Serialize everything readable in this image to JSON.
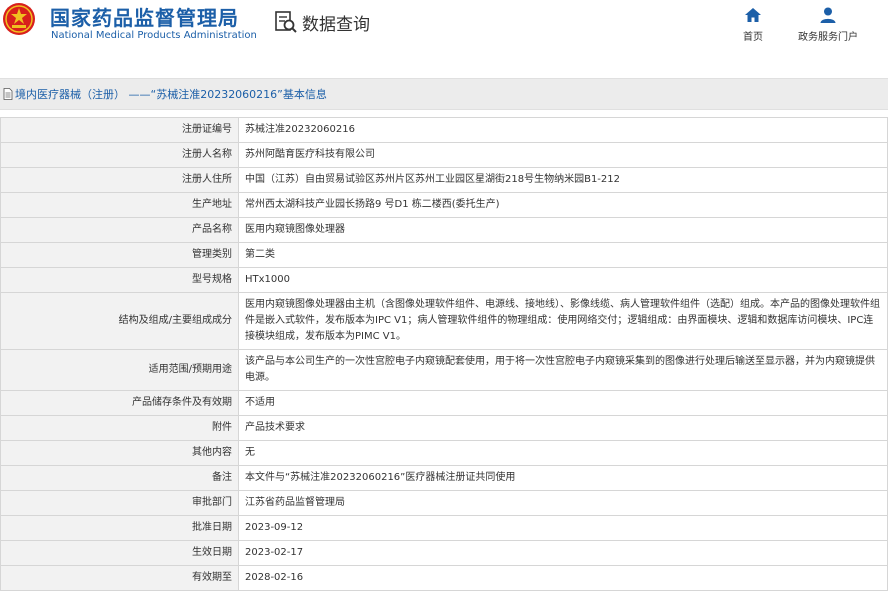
{
  "header": {
    "brand_cn": "国家药品监督管理局",
    "brand_en": "National Medical Products Administration",
    "query_title": "数据查询",
    "nav": [
      {
        "label": "首页",
        "icon": "home-icon"
      },
      {
        "label": "政务服务门户",
        "icon": "user-icon"
      }
    ]
  },
  "breadcrumb": {
    "text": "境内医疗器械（注册） ——“苏械注准20232060216”基本信息"
  },
  "fields": [
    {
      "label": "注册证编号",
      "value": "苏械注准20232060216"
    },
    {
      "label": "注册人名称",
      "value": "苏州阿酷育医疗科技有限公司"
    },
    {
      "label": "注册人住所",
      "value": "中国（江苏）自由贸易试验区苏州片区苏州工业园区星湖街218号生物纳米园B1-212"
    },
    {
      "label": "生产地址",
      "value": "常州西太湖科技产业园长扬路9 号D1 栋二楼西(委托生产)"
    },
    {
      "label": "产品名称",
      "value": "医用内窥镜图像处理器"
    },
    {
      "label": "管理类别",
      "value": "第二类"
    },
    {
      "label": "型号规格",
      "value": "HTx1000"
    },
    {
      "label": "结构及组成/主要组成成分",
      "value": "医用内窥镜图像处理器由主机（含图像处理软件组件、电源线、接地线）、影像线缆、病人管理软件组件（选配）组成。本产品的图像处理软件组件是嵌入式软件，发布版本为IPC V1；病人管理软件组件的物理组成：使用网络交付；逻辑组成：由界面模块、逻辑和数据库访问模块、IPC连接模块组成，发布版本为PIMC V1。"
    },
    {
      "label": "适用范围/预期用途",
      "value": "该产品与本公司生产的一次性宫腔电子内窥镜配套使用，用于将一次性宫腔电子内窥镜采集到的图像进行处理后输送至显示器，并为内窥镜提供电源。"
    },
    {
      "label": "产品储存条件及有效期",
      "value": "不适用"
    },
    {
      "label": "附件",
      "value": "产品技术要求"
    },
    {
      "label": "其他内容",
      "value": "无"
    },
    {
      "label": "备注",
      "value": "本文件与“苏械注准20232060216”医疗器械注册证共同使用"
    },
    {
      "label": "审批部门",
      "value": "江苏省药品监督管理局"
    },
    {
      "label": "批准日期",
      "value": "2023-09-12"
    },
    {
      "label": "生效日期",
      "value": "2023-02-17"
    },
    {
      "label": "有效期至",
      "value": "2028-02-16"
    }
  ],
  "colors": {
    "brand_blue": "#1c5fa8",
    "emblem_red": "#d8201c",
    "emblem_gold": "#f0c020"
  }
}
